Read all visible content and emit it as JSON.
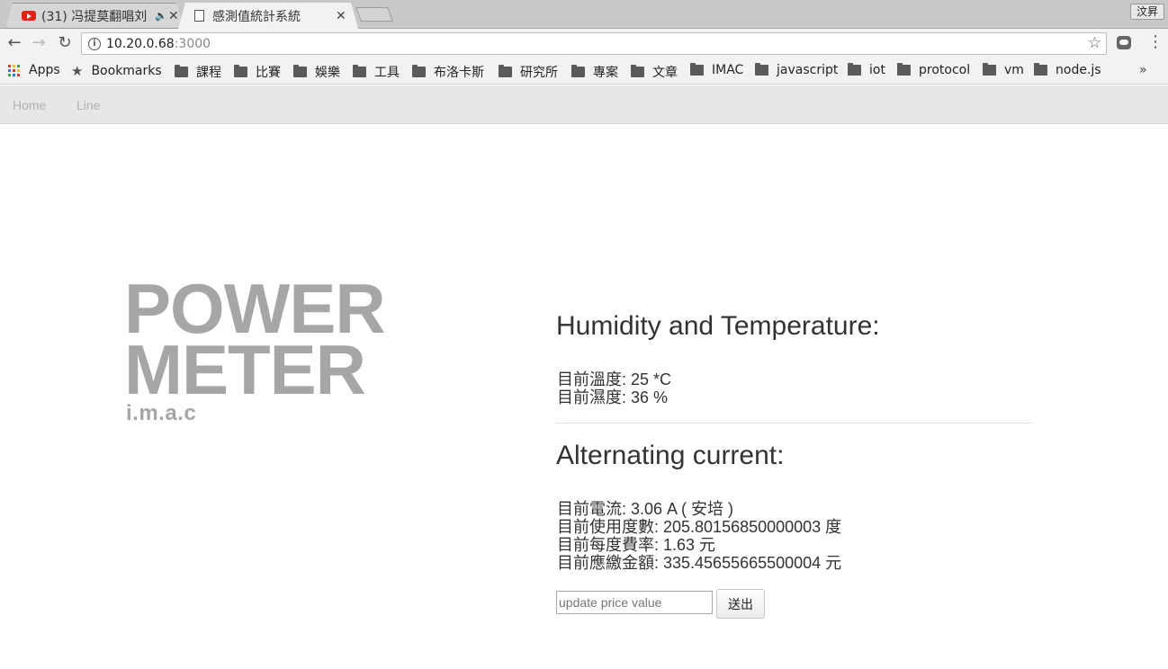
{
  "browser": {
    "tabs": [
      {
        "title": "(31) 冯提莫翻唱刘",
        "active": false
      },
      {
        "title": "感測值統計系統",
        "active": true
      }
    ],
    "profile_label": "汶昇",
    "url_host": "10.20.0.68",
    "url_port": ":3000",
    "bookmarks": {
      "apps": "Apps",
      "bookmarks": "Bookmarks",
      "folders": [
        "課程",
        "比賽",
        "娛樂",
        "工具",
        "布洛卡斯",
        "研究所",
        "專案",
        "文章",
        "IMAC",
        "javascript",
        "iot",
        "protocol",
        "vm",
        "node.js"
      ],
      "more": "»"
    },
    "icons": {
      "back": "back-arrow-icon",
      "forward": "forward-arrow-icon",
      "reload": "reload-icon",
      "info": "info-icon",
      "star": "star-icon",
      "menu": "more-vert-icon"
    }
  },
  "nav": {
    "home": "Home",
    "line": "Line"
  },
  "logo": {
    "line1": "POWER",
    "line2": "METER",
    "sub": "i.m.a.c"
  },
  "humidity": {
    "title": "Humidity and Temperature:",
    "temperature": "目前溫度: 25 *C",
    "humidity": "目前濕度: 36 %"
  },
  "ac": {
    "title": "Alternating current:",
    "current": "目前電流: 3.06 A ( 安培 )",
    "usage": "目前使用度數: 205.80156850000003 度",
    "rate": "目前每度費率: 1.63 元",
    "cost": "目前應繳金額: 335.45655665500004 元"
  },
  "form": {
    "placeholder": "update price value",
    "value": "",
    "submit": "送出"
  }
}
